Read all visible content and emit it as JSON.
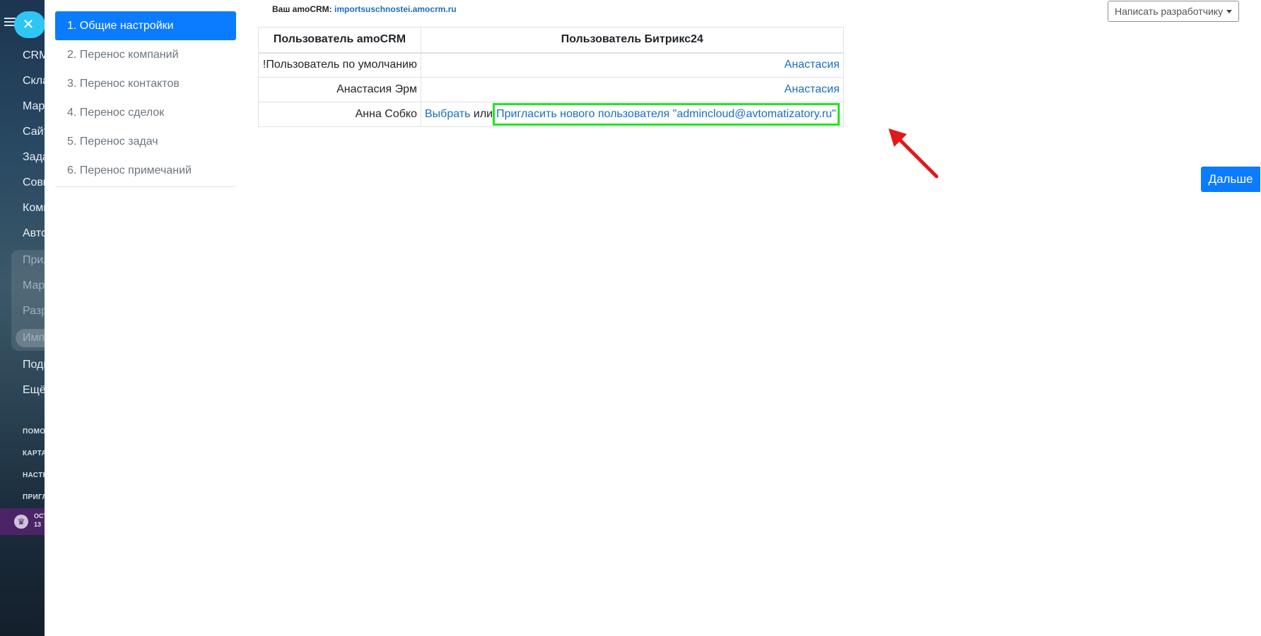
{
  "bitrix_sidebar": {
    "items": [
      "CRM",
      "Скла",
      "Мар",
      "Сайт",
      "Зада",
      "Совм",
      "Комп",
      "Авто",
      "Прил",
      "Мар",
      "Разр",
      "Имп",
      "Подп",
      "Ещё"
    ],
    "small_items": [
      "ПОМО",
      "КАРТА",
      "НАСТР",
      "ПРИГЛ"
    ],
    "promo": [
      "ОСТ",
      "13"
    ]
  },
  "steps": [
    {
      "label": "1. Общие настройки",
      "active": true
    },
    {
      "label": "2. Перенос компаний",
      "active": false
    },
    {
      "label": "3. Перенос контактов",
      "active": false
    },
    {
      "label": "4. Перенос сделок",
      "active": false
    },
    {
      "label": "5. Перенос задач",
      "active": false
    },
    {
      "label": "6. Перенос примечаний",
      "active": false
    }
  ],
  "account": {
    "label": "Ваш amoCRM:",
    "domain": "importsuschnostei.amocrm.ru"
  },
  "dev_button": "Написать разработчику",
  "next_button": "Дальше",
  "table": {
    "headers": [
      "Пользователь amoCRM",
      "Пользователь Битрикс24"
    ],
    "rows": [
      {
        "amo": "!Пользователь по умолчанию",
        "b24": "Анастасия"
      },
      {
        "amo": "Анастасия Эрм",
        "b24": "Анастасия"
      },
      {
        "amo": "Анна Собко",
        "choose": "Выбрать",
        "or": "или",
        "invite": "Пригласить нового пользователя \"admincloud@avtomatizatory.ru\""
      }
    ]
  },
  "colors": {
    "primary": "#0b7bff",
    "link": "#1b6ec2",
    "highlight": "#22e51f",
    "arrow": "#e0191b"
  }
}
